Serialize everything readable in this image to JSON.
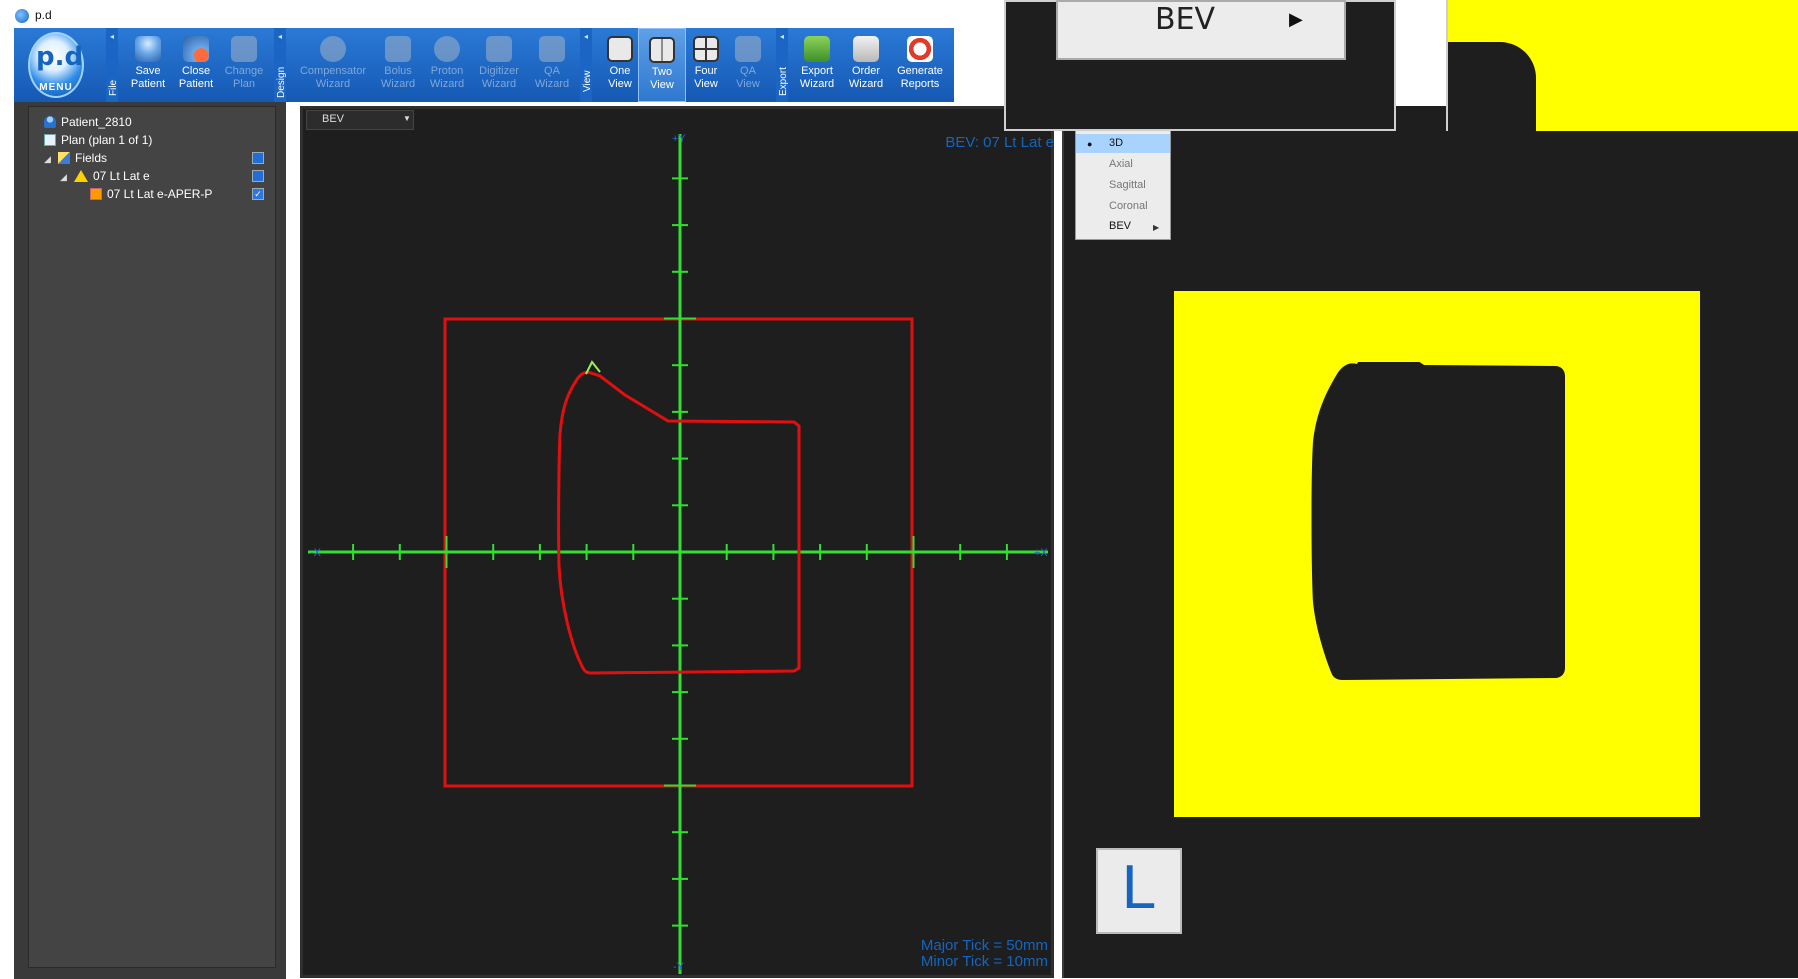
{
  "app": {
    "title": "p.d"
  },
  "menu": {
    "logo": "p.d",
    "label": "MENU"
  },
  "ribbon": {
    "groups": {
      "file": "File",
      "design": "Design",
      "view": "View",
      "export": "Export"
    },
    "buttons": [
      {
        "label1": "Save",
        "label2": "Patient",
        "icon": "save-patient-icon",
        "enabled": true
      },
      {
        "label1": "Close",
        "label2": "Patient",
        "icon": "close-patient-icon",
        "enabled": true
      },
      {
        "label1": "Change",
        "label2": "Plan",
        "icon": "change-plan-icon",
        "enabled": false
      },
      {
        "label1": "Compensator",
        "label2": "Wizard",
        "icon": "compensator-wizard-icon",
        "enabled": false
      },
      {
        "label1": "Bolus",
        "label2": "Wizard",
        "icon": "bolus-wizard-icon",
        "enabled": false
      },
      {
        "label1": "Proton",
        "label2": "Wizard",
        "icon": "proton-wizard-icon",
        "enabled": false
      },
      {
        "label1": "Digitizer",
        "label2": "Wizard",
        "icon": "digitizer-wizard-icon",
        "enabled": false
      },
      {
        "label1": "QA",
        "label2": "Wizard",
        "icon": "qa-wizard-icon",
        "enabled": false
      },
      {
        "label1": "One",
        "label2": "View",
        "icon": "one-view-icon",
        "enabled": true
      },
      {
        "label1": "Two",
        "label2": "View",
        "icon": "two-view-icon",
        "enabled": true,
        "selected": true
      },
      {
        "label1": "Four",
        "label2": "View",
        "icon": "four-view-icon",
        "enabled": true
      },
      {
        "label1": "QA",
        "label2": "View",
        "icon": "qa-view-icon",
        "enabled": false
      },
      {
        "label1": "Export",
        "label2": "Wizard",
        "icon": "export-wizard-icon",
        "enabled": true
      },
      {
        "label1": "Order",
        "label2": "Wizard",
        "icon": "order-wizard-icon",
        "enabled": true
      },
      {
        "label1": "Generate",
        "label2": "Reports",
        "icon": "generate-reports-icon",
        "enabled": true
      }
    ]
  },
  "tree": {
    "patient": "Patient_2810",
    "plan": "Plan (plan 1 of 1)",
    "fields": "Fields",
    "field": "07 Lt Lat e",
    "aperture": "07 Lt Lat e-APER-P"
  },
  "bev": {
    "dropdown": "BEV",
    "title": "BEV: 07 Lt Lat e",
    "axis_labels": {
      "plus_y": "+Y",
      "minus_y": "-Y",
      "plus_x": "+X",
      "minus_x": "-X"
    },
    "major_tick": "Major Tick = 50mm",
    "minor_tick": "Minor Tick = 10mm",
    "colors": {
      "axis": "#33dd33",
      "field": "#e01010",
      "background": "#1e1e1e"
    }
  },
  "view_menu": {
    "items": [
      "3D",
      "Axial",
      "Sagittal",
      "Coronal",
      "BEV"
    ],
    "selected": "3D"
  },
  "zoom_popup": {
    "label": "BEV"
  },
  "orientation": {
    "label": "L"
  },
  "colors": {
    "ribbon": "#1f6fd0",
    "aperture": "#ffff00",
    "label_blue": "#1565c0"
  }
}
